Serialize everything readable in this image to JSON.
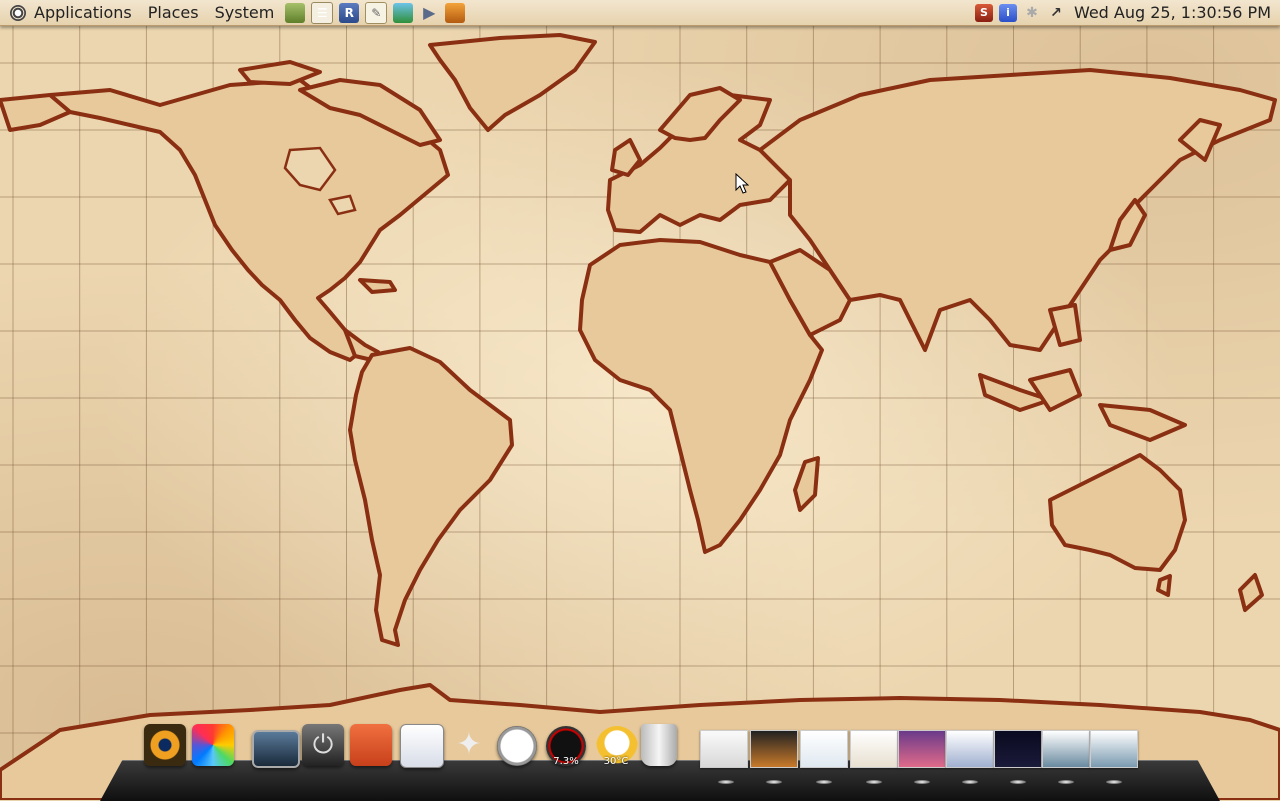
{
  "panel": {
    "menus": [
      "Applications",
      "Places",
      "System"
    ],
    "launchers": [
      "book-icon",
      "notes-icon",
      "r-icon",
      "text-editor-icon",
      "network-icon",
      "play-icon",
      "camera-icon"
    ],
    "tray": [
      "flash-icon",
      "info-icon",
      "bluetooth-icon",
      "network-status-icon"
    ],
    "clock": "Wed Aug 25,  1:30:56 PM"
  },
  "dock": {
    "apps": [
      "finder-eye-icon",
      "color-wheel-icon",
      "desktop-icon",
      "power-icon",
      "ubuntu-icon",
      "writer-icon",
      "mail-crane-icon",
      "clock-icon",
      "cpu-gauge-icon",
      "weather-icon",
      "trash-icon"
    ],
    "cpu_label": "7.3%",
    "weather_label": "30°C",
    "window_count": 10
  },
  "colors": {
    "land": "#e7c99c",
    "coast": "#8a2f12",
    "paper": "#ecd6b0",
    "grid": "#7a5a3a"
  }
}
